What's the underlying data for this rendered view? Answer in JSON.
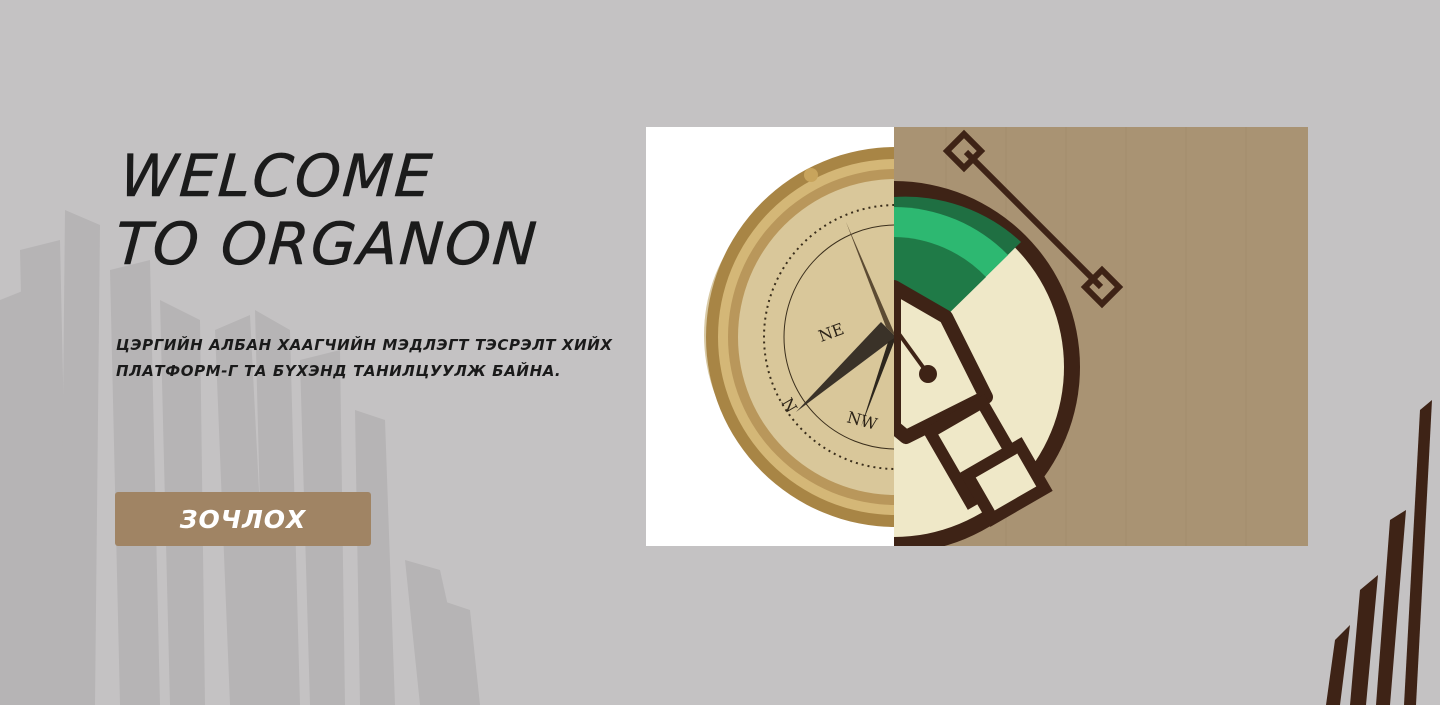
{
  "hero": {
    "title_line1": "WELCOME",
    "title_line2": "TO ORGANON",
    "subtitle": "ЦЭРГИЙН АЛБАН ХААГЧИЙН МЭДЛЭГТ ТЭСРЭЛТ ХИЙХ ПЛАТФОРМ-Г ТА БҮХЭНД ТАНИЛЦУУЛЖ БАЙНА.",
    "button_label": "ЗОЧЛОХ"
  },
  "image": {
    "left_half": "compass-photo",
    "right_half": "pen-logo-illustration",
    "compass_labels": [
      "NE",
      "NW",
      "N"
    ]
  },
  "colors": {
    "background": "#c4c2c3",
    "button": "#a08464",
    "text": "#1b1b1b",
    "logo_dark": "#3e2316",
    "logo_cream": "#efe8c8",
    "logo_green": "#2db871",
    "cardboard": "#a99373"
  }
}
